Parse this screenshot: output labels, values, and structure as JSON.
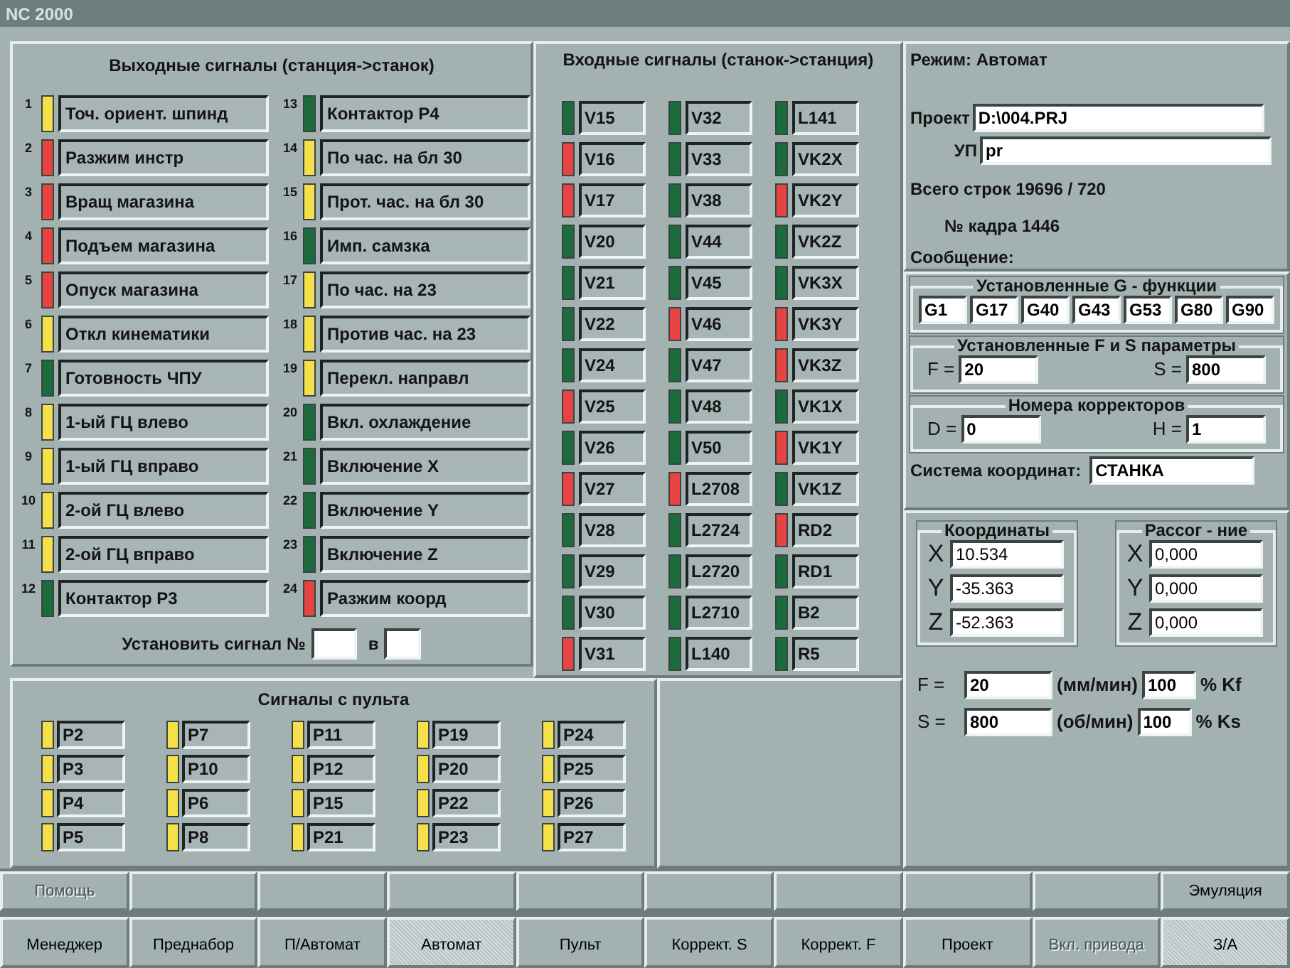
{
  "window": {
    "title": "NC 2000"
  },
  "output_signals": {
    "title": "Выходные сигналы (станция->станок)",
    "signals": [
      {
        "number": "1",
        "label": "Точ. ориент. шпинд",
        "color": "#f5e04a"
      },
      {
        "number": "2",
        "label": "Разжим инстр",
        "color": "#e84343"
      },
      {
        "number": "3",
        "label": "Вращ магазина",
        "color": "#e84343"
      },
      {
        "number": "4",
        "label": "Подъем магазина",
        "color": "#e84343"
      },
      {
        "number": "5",
        "label": "Опуск магазина",
        "color": "#e84343"
      },
      {
        "number": "6",
        "label": "Откл кинематики",
        "color": "#f5e04a"
      },
      {
        "number": "7",
        "label": "Готовность ЧПУ",
        "color": "#1c6b3c"
      },
      {
        "number": "8",
        "label": "1-ый ГЦ влево",
        "color": "#f5e04a"
      },
      {
        "number": "9",
        "label": "1-ый ГЦ вправо",
        "color": "#f5e04a"
      },
      {
        "number": "10",
        "label": "2-ой ГЦ влево",
        "color": "#f5e04a"
      },
      {
        "number": "11",
        "label": "2-ой ГЦ вправо",
        "color": "#f5e04a"
      },
      {
        "number": "12",
        "label": "Контактор Р3",
        "color": "#1c6b3c"
      },
      {
        "number": "13",
        "label": "Контактор Р4",
        "color": "#1c6b3c"
      },
      {
        "number": "14",
        "label": "По час. на бл 30",
        "color": "#f5e04a"
      },
      {
        "number": "15",
        "label": "Прот. час. на бл 30",
        "color": "#f5e04a"
      },
      {
        "number": "16",
        "label": "Имп. самзка",
        "color": "#1c6b3c"
      },
      {
        "number": "17",
        "label": "По час. на 23",
        "color": "#f5e04a"
      },
      {
        "number": "18",
        "label": "Против час. на 23",
        "color": "#f5e04a"
      },
      {
        "number": "19",
        "label": "Перекл. направл",
        "color": "#f5e04a"
      },
      {
        "number": "20",
        "label": "Вкл. охлаждение",
        "color": "#1c6b3c"
      },
      {
        "number": "21",
        "label": "Включение X",
        "color": "#1c6b3c"
      },
      {
        "number": "22",
        "label": "Включение Y",
        "color": "#1c6b3c"
      },
      {
        "number": "23",
        "label": "Включение Z",
        "color": "#1c6b3c"
      },
      {
        "number": "24",
        "label": "Разжим коорд",
        "color": "#e84343"
      }
    ],
    "set_signal": {
      "label": "Установить сигнал №",
      "separator": "в"
    }
  },
  "input_signals": {
    "title": "Входные сигналы (станок->станция)",
    "columns": [
      [
        {
          "label": "V15",
          "color": "#1c6b3c"
        },
        {
          "label": "V16",
          "color": "#e84343"
        },
        {
          "label": "V17",
          "color": "#e84343"
        },
        {
          "label": "V20",
          "color": "#1c6b3c"
        },
        {
          "label": "V21",
          "color": "#1c6b3c"
        },
        {
          "label": "V22",
          "color": "#1c6b3c"
        },
        {
          "label": "V24",
          "color": "#1c6b3c"
        },
        {
          "label": "V25",
          "color": "#e84343"
        },
        {
          "label": "V26",
          "color": "#1c6b3c"
        },
        {
          "label": "V27",
          "color": "#e84343"
        },
        {
          "label": "V28",
          "color": "#1c6b3c"
        },
        {
          "label": "V29",
          "color": "#1c6b3c"
        },
        {
          "label": "V30",
          "color": "#1c6b3c"
        },
        {
          "label": "V31",
          "color": "#e84343"
        }
      ],
      [
        {
          "label": "V32",
          "color": "#1c6b3c"
        },
        {
          "label": "V33",
          "color": "#1c6b3c"
        },
        {
          "label": "V38",
          "color": "#1c6b3c"
        },
        {
          "label": "V44",
          "color": "#1c6b3c"
        },
        {
          "label": "V45",
          "color": "#1c6b3c"
        },
        {
          "label": "V46",
          "color": "#e84343"
        },
        {
          "label": "V47",
          "color": "#1c6b3c"
        },
        {
          "label": "V48",
          "color": "#1c6b3c"
        },
        {
          "label": "V50",
          "color": "#1c6b3c"
        },
        {
          "label": "L2708",
          "color": "#e84343"
        },
        {
          "label": "L2724",
          "color": "#1c6b3c"
        },
        {
          "label": "L2720",
          "color": "#1c6b3c"
        },
        {
          "label": "L2710",
          "color": "#1c6b3c"
        },
        {
          "label": "L140",
          "color": "#1c6b3c"
        }
      ],
      [
        {
          "label": "L141",
          "color": "#1c6b3c"
        },
        {
          "label": "VK2X",
          "color": "#1c6b3c"
        },
        {
          "label": "VK2Y",
          "color": "#e84343"
        },
        {
          "label": "VK2Z",
          "color": "#1c6b3c"
        },
        {
          "label": "VK3X",
          "color": "#1c6b3c"
        },
        {
          "label": "VK3Y",
          "color": "#e84343"
        },
        {
          "label": "VK3Z",
          "color": "#e84343"
        },
        {
          "label": "VK1X",
          "color": "#1c6b3c"
        },
        {
          "label": "VK1Y",
          "color": "#e84343"
        },
        {
          "label": "VK1Z",
          "color": "#1c6b3c"
        },
        {
          "label": "RD2",
          "color": "#e84343"
        },
        {
          "label": "RD1",
          "color": "#1c6b3c"
        },
        {
          "label": "B2",
          "color": "#1c6b3c"
        },
        {
          "label": "R5",
          "color": "#1c6b3c"
        }
      ]
    ]
  },
  "panel_signals": {
    "title": "Сигналы с пульта",
    "columns": [
      [
        {
          "label": "P2",
          "color": "#f5e04a"
        },
        {
          "label": "P3",
          "color": "#f5e04a"
        },
        {
          "label": "P4",
          "color": "#f5e04a"
        },
        {
          "label": "P5",
          "color": "#f5e04a"
        }
      ],
      [
        {
          "label": "P7",
          "color": "#f5e04a"
        },
        {
          "label": "P10",
          "color": "#f5e04a"
        },
        {
          "label": "P6",
          "color": "#f5e04a"
        },
        {
          "label": "P8",
          "color": "#f5e04a"
        }
      ],
      [
        {
          "label": "P11",
          "color": "#f5e04a"
        },
        {
          "label": "P12",
          "color": "#f5e04a"
        },
        {
          "label": "P15",
          "color": "#f5e04a"
        },
        {
          "label": "P21",
          "color": "#f5e04a"
        }
      ],
      [
        {
          "label": "P19",
          "color": "#f5e04a"
        },
        {
          "label": "P20",
          "color": "#f5e04a"
        },
        {
          "label": "P22",
          "color": "#f5e04a"
        },
        {
          "label": "P23",
          "color": "#f5e04a"
        }
      ],
      [
        {
          "label": "P24",
          "color": "#f5e04a"
        },
        {
          "label": "P25",
          "color": "#f5e04a"
        },
        {
          "label": "P26",
          "color": "#f5e04a"
        },
        {
          "label": "P27",
          "color": "#f5e04a"
        }
      ]
    ]
  },
  "status": {
    "mode": "Режим: Автомат",
    "project": {
      "label": "Проект",
      "value": "D:\\004.PRJ"
    },
    "program": {
      "label": "УП",
      "value": "pr"
    },
    "total_lines": "Всего строк 19696 / 720",
    "frame": "№ кадра 1446",
    "message": "Сообщение:"
  },
  "g_functions": {
    "title": "Установленные G - функции",
    "values": [
      "G1",
      "G17",
      "G40",
      "G43",
      "G53",
      "G80",
      "G90"
    ]
  },
  "fs_params": {
    "title": "Установленные F и S параметры",
    "fields": [
      {
        "label": "F =",
        "value": "20"
      },
      {
        "label": "S =",
        "value": "800"
      }
    ]
  },
  "correctors": {
    "title": "Номера корректоров",
    "fields": [
      {
        "label": "D =",
        "value": "0"
      },
      {
        "label": "H =",
        "value": "1"
      }
    ]
  },
  "coordinate_system": {
    "label": "Система координат:",
    "value": "СТАНКА"
  },
  "coordinates": {
    "title": "Координаты",
    "axes": [
      {
        "axis": "X",
        "value": "10.534"
      },
      {
        "axis": "Y",
        "value": "-35.363"
      },
      {
        "axis": "Z",
        "value": "-52.363"
      }
    ]
  },
  "deviation": {
    "title": "Рассог - ние",
    "axes": [
      {
        "axis": "X",
        "value": "0,000"
      },
      {
        "axis": "Y",
        "value": "0,000"
      },
      {
        "axis": "Z",
        "value": "0,000"
      }
    ]
  },
  "feeds": [
    {
      "label": "F =",
      "value": "20",
      "unit": "(мм/мин)",
      "percent": "100",
      "factor": "% Kf"
    },
    {
      "label": "S =",
      "value": "800",
      "unit": "(об/мин)",
      "percent": "100",
      "factor": "% Ks"
    }
  ],
  "function_keys_top": [
    {
      "kind": "key",
      "label": "Помощь",
      "disabled": true
    },
    {
      "kind": "blank"
    },
    {
      "kind": "blank"
    },
    {
      "kind": "blank"
    },
    {
      "kind": "blank"
    },
    {
      "kind": "blank"
    },
    {
      "kind": "blank"
    },
    {
      "kind": "blank"
    },
    {
      "kind": "blank"
    },
    {
      "kind": "key",
      "label": "Эмуляция",
      "disabled": false
    }
  ],
  "function_keys_bottom": [
    {
      "label": "Менеджер",
      "selected": false,
      "disabled": false
    },
    {
      "label": "Преднабор",
      "selected": false,
      "disabled": false
    },
    {
      "label": "П/Автомат",
      "selected": false,
      "disabled": false
    },
    {
      "label": "Автомат",
      "selected": true,
      "disabled": false
    },
    {
      "label": "Пульт",
      "selected": false,
      "disabled": false
    },
    {
      "label": "Коррект. S",
      "selected": false,
      "disabled": false
    },
    {
      "label": "Коррект. F",
      "selected": false,
      "disabled": false
    },
    {
      "label": "Проект",
      "selected": false,
      "disabled": false
    },
    {
      "label": "Вкл. привода",
      "selected": false,
      "disabled": true
    },
    {
      "label": "З/А",
      "selected": true,
      "disabled": false
    }
  ]
}
